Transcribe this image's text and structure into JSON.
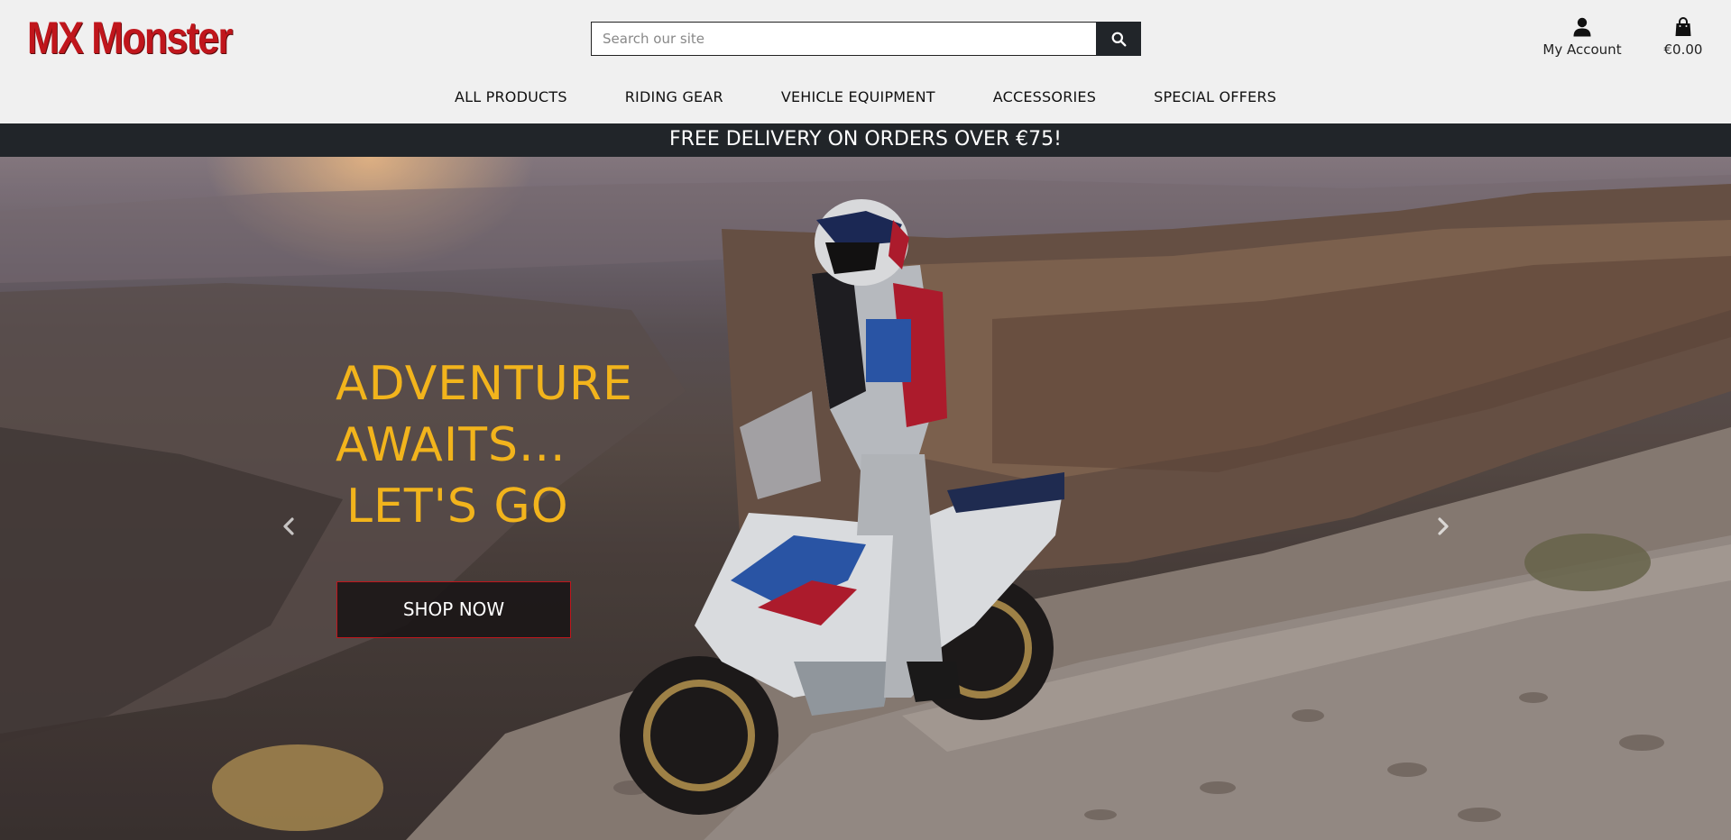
{
  "brand": {
    "logo_text": "MX Monster",
    "logo_color": "#c0161c"
  },
  "search": {
    "placeholder": "Search our site",
    "value": "",
    "button_icon": "search-icon"
  },
  "account": {
    "label": "My Account",
    "icon": "user-icon"
  },
  "cart": {
    "total": "€0.00",
    "icon": "shopping-bag-icon"
  },
  "nav": {
    "items": [
      {
        "label": "ALL PRODUCTS"
      },
      {
        "label": "RIDING GEAR"
      },
      {
        "label": "VEHICLE EQUIPMENT"
      },
      {
        "label": "ACCESSORIES"
      },
      {
        "label": "SPECIAL OFFERS"
      }
    ]
  },
  "banner": {
    "text": "FREE DELIVERY ON ORDERS OVER €75!",
    "background": "#212529"
  },
  "hero": {
    "headline_lines": [
      "ADVENTURE",
      "AWAITS...",
      "LET'S GO"
    ],
    "headline_color": "#f2b41c",
    "cta_label": "SHOP NOW",
    "prev_icon": "chevron-left-icon",
    "next_icon": "chevron-right-icon"
  }
}
